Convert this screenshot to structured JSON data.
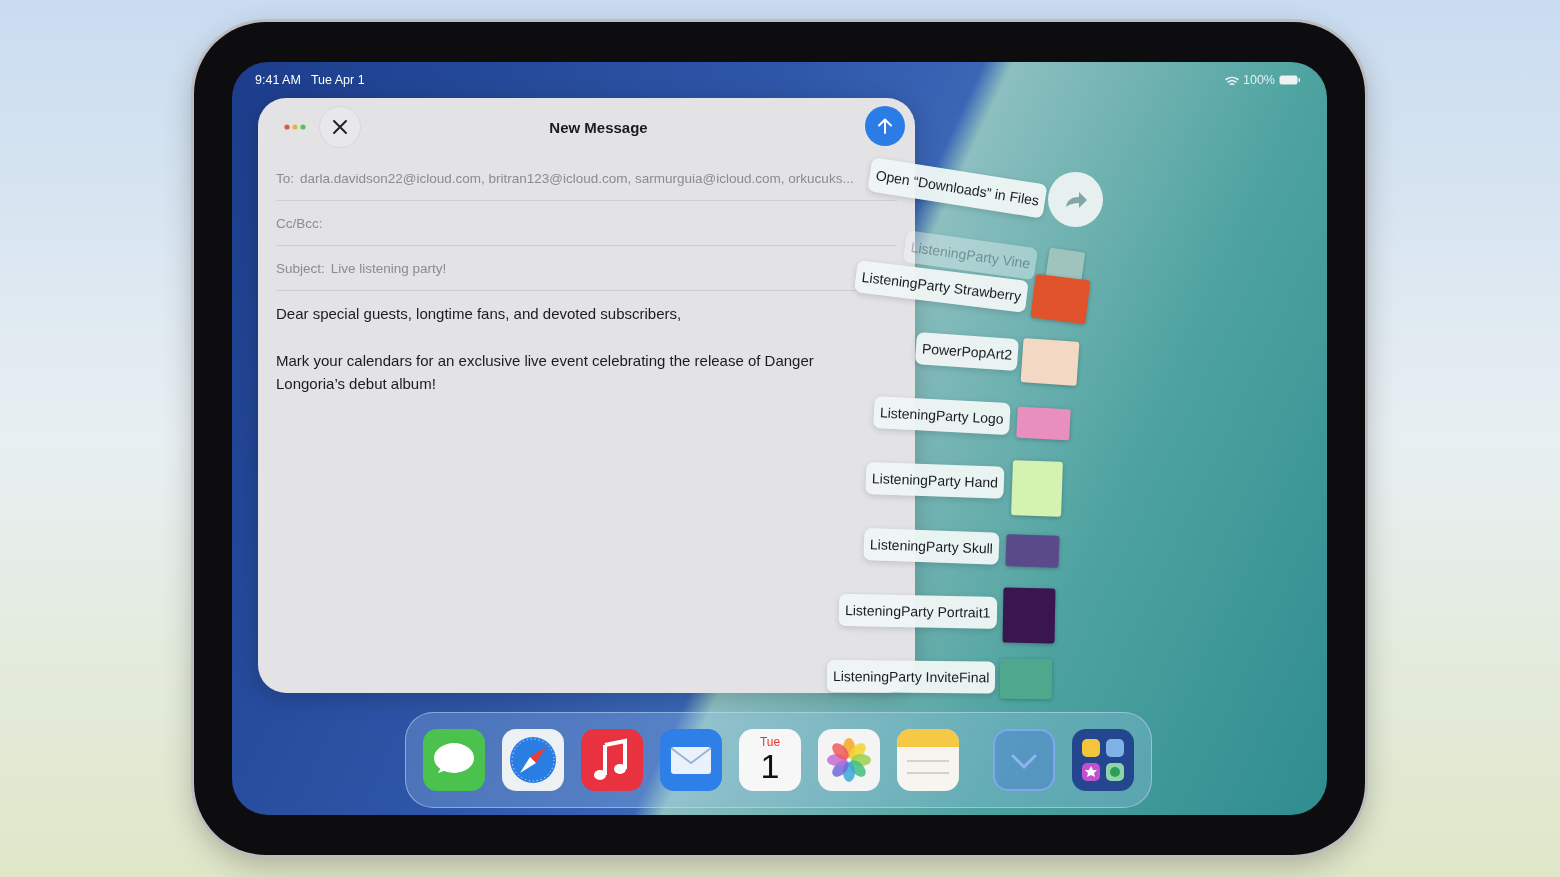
{
  "status_bar": {
    "time": "9:41 AM",
    "date": "Tue Apr 1",
    "battery": "100%"
  },
  "compose": {
    "title": "New Message",
    "to_label": "To:",
    "to": "darla.davidson22@icloud.com, britran123@icloud.com, sarmurguia@icloud.com, orkucuks...",
    "cc_label": "Cc/Bcc:",
    "subject_label": "Subject:",
    "subject": "Live listening party!",
    "body": [
      "Dear special guests, longtime fans, and devoted subscribers,",
      "Mark your calendars for an exclusive live event celebrating the release of Danger Longoria’s debut album!"
    ]
  },
  "drag_stack": {
    "action": "Open “Downloads” in Files",
    "items": [
      {
        "name": "ListeningParty Vine",
        "faded": true,
        "color": "#9fc4bd"
      },
      {
        "name": "ListeningParty Strawberry",
        "faded": false,
        "color": "#e0522a"
      },
      {
        "name": "PowerPopArt2",
        "faded": false,
        "color": "#f3d9c4"
      },
      {
        "name": "ListeningParty Logo",
        "faded": false,
        "color": "#e98fbf"
      },
      {
        "name": "ListeningParty Hand",
        "faded": false,
        "color": "#d4f2b0"
      },
      {
        "name": "ListeningParty Skull",
        "faded": false,
        "color": "#5a4a8a"
      },
      {
        "name": "ListeningParty Portrait1",
        "faded": false,
        "color": "#3a1650"
      },
      {
        "name": "ListeningParty InviteFinal",
        "faded": false,
        "color": "#4fa88e"
      }
    ]
  },
  "dock": {
    "apps": [
      {
        "kind": "messages"
      },
      {
        "kind": "browser"
      },
      {
        "kind": "music"
      },
      {
        "kind": "mail"
      },
      {
        "kind": "calendar",
        "day": "Tue",
        "date": "1"
      },
      {
        "kind": "photos"
      },
      {
        "kind": "notes"
      }
    ],
    "recents": [
      {
        "kind": "downloads"
      },
      {
        "kind": "app-library"
      }
    ]
  }
}
